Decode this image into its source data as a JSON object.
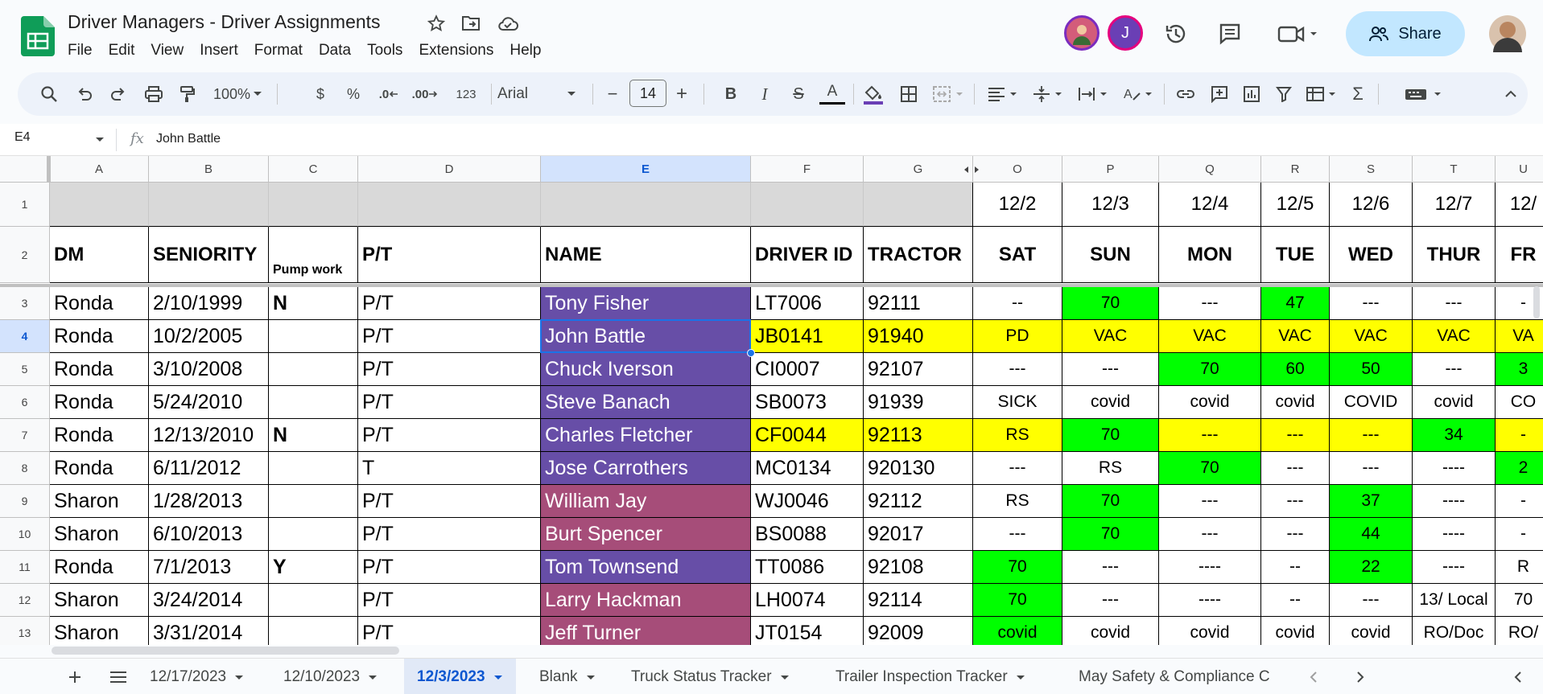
{
  "doc": {
    "title": "Driver Managers - Driver Assignments",
    "menu": [
      "File",
      "Edit",
      "View",
      "Insert",
      "Format",
      "Data",
      "Tools",
      "Extensions",
      "Help"
    ],
    "avatar_letter": "J",
    "share_label": "Share"
  },
  "toolbar": {
    "zoom": "100%",
    "currency": "$",
    "percent": "%",
    "dec_decrease": ".0",
    "dec_increase": ".00",
    "number_format": "123",
    "font": "Arial",
    "font_size": "14",
    "minus": "−",
    "plus": "+",
    "bold": "B",
    "italic": "I",
    "strike": "S",
    "text_color": "A",
    "sigma": "Σ"
  },
  "formula_bar": {
    "cell_ref": "E4",
    "content": "John Battle"
  },
  "columns": [
    "A",
    "B",
    "C",
    "D",
    "E",
    "F",
    "G",
    "O",
    "P",
    "Q",
    "R",
    "S",
    "T",
    "U"
  ],
  "row_numbers": [
    "1",
    "2",
    "3",
    "4",
    "5",
    "6",
    "7",
    "8",
    "9",
    "10",
    "11",
    "12",
    "13"
  ],
  "date_row": [
    "",
    "",
    "",
    "",
    "",
    "",
    "",
    "12/2",
    "12/3",
    "12/4",
    "12/5",
    "12/6",
    "12/7",
    "12/"
  ],
  "header_row": [
    "DM",
    "SENIORITY",
    "Pump work",
    "P/T",
    "NAME",
    "DRIVER ID",
    "TRACTOR",
    "SAT",
    "SUN",
    "MON",
    "TUE",
    "WED",
    "THUR",
    "FR"
  ],
  "rows": [
    [
      "Ronda",
      "2/10/1999",
      "N",
      "P/T",
      "Tony Fisher",
      "LT7006",
      "92111",
      "--",
      "70",
      "---",
      "47",
      "---",
      "---",
      "-"
    ],
    [
      "Ronda",
      "10/2/2005",
      "",
      "P/T",
      "John Battle",
      "JB0141",
      "91940",
      "PD",
      "VAC",
      "VAC",
      "VAC",
      "VAC",
      "VAC",
      "VA"
    ],
    [
      "Ronda",
      "3/10/2008",
      "",
      "P/T",
      "Chuck Iverson",
      "CI0007",
      "92107",
      "---",
      "---",
      "70",
      "60",
      "50",
      "---",
      "3"
    ],
    [
      "Ronda",
      "5/24/2010",
      "",
      "P/T",
      "Steve Banach",
      "SB0073",
      "91939",
      "SICK",
      "covid",
      "covid",
      "covid",
      "COVID",
      "covid",
      "CO"
    ],
    [
      "Ronda",
      "12/13/2010",
      "N",
      "P/T",
      "Charles Fletcher",
      "CF0044",
      "92113",
      "RS",
      "70",
      "---",
      "---",
      "---",
      "34",
      "-"
    ],
    [
      "Ronda",
      "6/11/2012",
      "",
      "T",
      "Jose Carrothers",
      "MC0134",
      "920130",
      "---",
      "RS",
      "70",
      "---",
      "---",
      "----",
      "2"
    ],
    [
      "Sharon",
      "1/28/2013",
      "",
      "P/T",
      "William Jay",
      "WJ0046",
      "92112",
      "RS",
      "70",
      "---",
      "---",
      "37",
      "----",
      "-"
    ],
    [
      "Sharon",
      "6/10/2013",
      "",
      "P/T",
      "Burt Spencer",
      "BS0088",
      "92017",
      "---",
      "70",
      "---",
      "---",
      "44",
      "----",
      "-"
    ],
    [
      "Ronda",
      "7/1/2013",
      "Y",
      "P/T",
      "Tom Townsend",
      "TT0086",
      "92108",
      "70",
      "---",
      "----",
      "--",
      "22",
      "----",
      "R"
    ],
    [
      "Sharon",
      "3/24/2014",
      "",
      "P/T",
      "Larry Hackman",
      "LH0074",
      "92114",
      "70",
      "---",
      "----",
      "--",
      "---",
      "13/ Local",
      "70"
    ],
    [
      "Sharon",
      "3/31/2014",
      "",
      "P/T",
      "Jeff Turner",
      "JT0154",
      "92009",
      "covid",
      "covid",
      "covid",
      "covid",
      "covid",
      "RO/Doc",
      "RO/"
    ]
  ],
  "fills": [
    [
      "",
      "",
      "",
      "",
      "purple",
      "",
      "",
      "",
      "green",
      "",
      "green",
      "",
      "",
      ""
    ],
    [
      "",
      "",
      "",
      "",
      "purple",
      "yellow",
      "yellow",
      "yellow",
      "yellow",
      "yellow",
      "yellow",
      "yellow",
      "yellow",
      "yellow"
    ],
    [
      "",
      "",
      "",
      "",
      "purple",
      "",
      "",
      "",
      "",
      "green",
      "green",
      "green",
      "",
      "green"
    ],
    [
      "",
      "",
      "",
      "",
      "purple",
      "",
      "",
      "",
      "",
      "",
      "",
      "",
      "",
      ""
    ],
    [
      "",
      "",
      "",
      "",
      "purple",
      "yellow",
      "yellow",
      "yellow",
      "green",
      "yellow",
      "yellow",
      "yellow",
      "green",
      "yellow"
    ],
    [
      "",
      "",
      "",
      "",
      "purple",
      "",
      "",
      "",
      "",
      "green",
      "",
      "",
      "",
      "green"
    ],
    [
      "",
      "",
      "",
      "",
      "rose",
      "",
      "",
      "",
      "green",
      "",
      "",
      "green",
      "",
      ""
    ],
    [
      "",
      "",
      "",
      "",
      "rose",
      "",
      "",
      "",
      "green",
      "",
      "",
      "green",
      "",
      ""
    ],
    [
      "",
      "",
      "",
      "",
      "purple",
      "",
      "",
      "green",
      "",
      "",
      "",
      "green",
      "",
      ""
    ],
    [
      "",
      "",
      "",
      "",
      "rose",
      "",
      "",
      "green",
      "",
      "",
      "",
      "",
      "",
      ""
    ],
    [
      "",
      "",
      "",
      "",
      "rose",
      "",
      "",
      "green",
      "",
      "",
      "",
      "",
      "",
      ""
    ]
  ],
  "colors": {
    "purple": "#674ea7",
    "rose": "#a64d79",
    "yellow": "#ffff00",
    "green": "#00ff00",
    "header_gray": "#d9d9d9",
    "share_bg": "#c2e7ff",
    "avatar_purple": "#6a3fb5",
    "selection_blue": "#1a73e8"
  },
  "selected_cell": {
    "row": 1,
    "col": 4
  },
  "sheets": [
    "12/17/2023",
    "12/10/2023",
    "12/3/2023",
    "Blank",
    "Truck Status Tracker",
    "Trailer Inspection Tracker",
    "May Safety & Compliance C"
  ],
  "active_sheet": "12/3/2023"
}
